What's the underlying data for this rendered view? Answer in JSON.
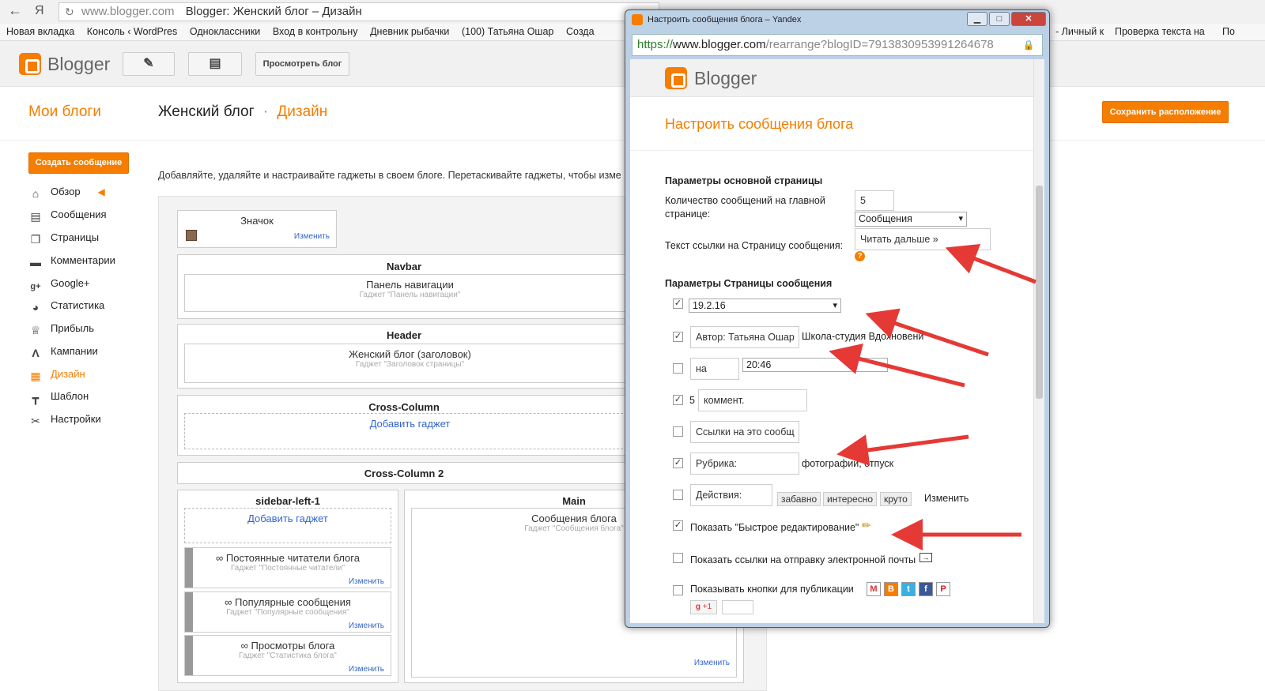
{
  "browser": {
    "back_icon": "arrow-left-icon",
    "yandex_glyph": "Я",
    "url_host": "www.blogger.com",
    "tab_title": "Blogger: Женский блог – Дизайн",
    "bookmarks": [
      "Новая вкладка",
      "Консоль ‹ WordPres",
      "Одноклассники",
      "Вход в контрольну",
      "Дневник рыбачки",
      "(100) Татьяна Ошар",
      "Созда"
    ],
    "bookmarks_right": [
      "- Личный к",
      "Проверка текста на",
      "По"
    ]
  },
  "blogger_header": {
    "logo_text": "Blogger",
    "view_blog_label": "Просмотреть блог"
  },
  "page": {
    "my_blogs": "Мои блоги",
    "blog_name": "Женский блог",
    "separator": "·",
    "section": "Дизайн",
    "save_layout_label": "Сохранить расположение",
    "new_post_label": "Создать сообщение",
    "description": "Добавляйте, удаляйте и настраивайте гаджеты в своем блоге. Перетаскивайте гаджеты, чтобы изме"
  },
  "sidebar": {
    "items": [
      {
        "label": "Обзор",
        "icon": "home-icon"
      },
      {
        "label": "Сообщения",
        "icon": "posts-icon"
      },
      {
        "label": "Страницы",
        "icon": "pages-icon"
      },
      {
        "label": "Комментарии",
        "icon": "comments-icon"
      },
      {
        "label": "Google+",
        "icon": "google-plus-icon"
      },
      {
        "label": "Статистика",
        "icon": "stats-icon"
      },
      {
        "label": "Прибыль",
        "icon": "trophy-icon"
      },
      {
        "label": "Кампании",
        "icon": "campaigns-icon"
      },
      {
        "label": "Дизайн",
        "icon": "layout-icon"
      },
      {
        "label": "Шаблон",
        "icon": "template-icon"
      },
      {
        "label": "Настройки",
        "icon": "wrench-icon"
      }
    ]
  },
  "layout": {
    "favicon": {
      "title": "Значок",
      "edit": "Изменить"
    },
    "navbar": {
      "title": "Navbar",
      "gadget": "Панель навигации",
      "sub": "Гаджет \"Панель навигации\""
    },
    "header": {
      "title": "Header",
      "gadget": "Женский блог (заголовок)",
      "sub": "Гаджет \"Заголовок страницы\""
    },
    "cross_column": {
      "title": "Cross-Column",
      "add": "Добавить гаджет"
    },
    "cross_column_2": {
      "title": "Cross-Column 2"
    },
    "sidebar_left": {
      "title": "sidebar-left-1",
      "add": "Добавить гаджет",
      "gadgets": [
        {
          "title": "∞ Постоянные читатели блога",
          "sub": "Гаджет \"Постоянные читатели\"",
          "edit": "Изменить"
        },
        {
          "title": "∞ Популярные сообщения",
          "sub": "Гаджет \"Популярные сообщения\"",
          "edit": "Изменить"
        },
        {
          "title": "∞ Просмотры блога",
          "sub": "Гаджет \"Статистика блога\"",
          "edit": "Изменить"
        }
      ]
    },
    "main": {
      "title": "Main",
      "gadget": "Сообщения блога",
      "sub": "Гаджет \"Сообщения блога\"",
      "edit": "Изменить"
    }
  },
  "popup": {
    "window_title": "Настроить сообщения блога – Yandex",
    "url_https": "https://",
    "url_host": "www.blogger.com",
    "url_path": "/rearrange?blogID=7913830953991264678",
    "logo_text": "Blogger",
    "heading": "Настроить сообщения блога",
    "main_section": "Параметры основной страницы",
    "posts_count_label": "Количество сообщений на главной странице:",
    "posts_count_value": "5",
    "posts_unit": "Сообщения",
    "read_more_label": "Текст ссылки на Страницу сообщения:",
    "read_more_value": "Читать дальше »",
    "help_icon": "help-icon",
    "post_section": "Параметры Страницы сообщения",
    "date_format": "19.2.16",
    "author_prefix": "Автор: Татьяна Ошар",
    "author_name": "Школа-студия Вдохновени",
    "time_prefix": "на",
    "time_value": "20:46",
    "comments_count": "5",
    "comments_label": "коммент.",
    "backlinks_label": "Ссылки на это сообщ",
    "labels_prefix": "Рубрика:",
    "labels_value": "фотографии, отпуск",
    "reactions_prefix": "Действия:",
    "reactions": [
      "забавно",
      "интересно",
      "круто"
    ],
    "reactions_edit": "Изменить",
    "quick_edit": "Показать \"Быстрое редактирование\"",
    "email_links": "Показать ссылки на отправку электронной почты",
    "share_buttons": "Показывать кнопки для публикации",
    "gplus_label": "+1",
    "checkmark": "✓"
  },
  "colors": {
    "accent": "#f57d00",
    "link": "#3366cc",
    "arrow": "#e53935"
  }
}
